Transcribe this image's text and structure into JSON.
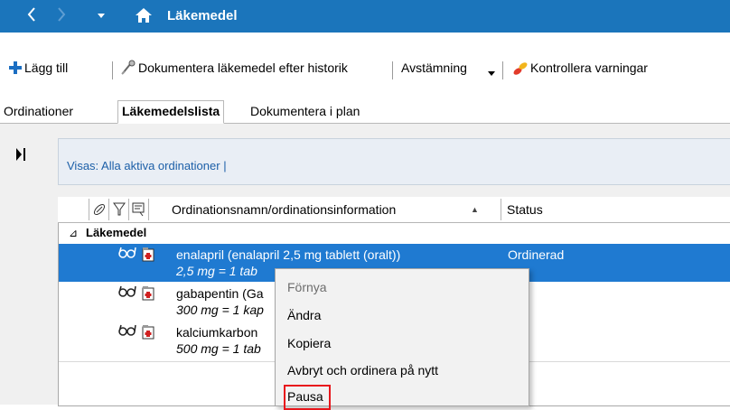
{
  "titlebar": {
    "title": "Läkemedel",
    "back_glyph": "‹",
    "forward_glyph": "›",
    "dropdown_glyph": "▾",
    "accent": "#1b75bb"
  },
  "toolbar": {
    "add_label": "Lägg till",
    "document_history_label": "Dokumentera läkemedel efter historik",
    "reconcile_label": "Avstämning",
    "check_warnings_label": "Kontrollera varningar"
  },
  "tabs": [
    {
      "label": "Ordinationer"
    },
    {
      "label": "Läkemedelslista"
    },
    {
      "label": "Dokumentera i plan"
    }
  ],
  "filter": {
    "text": "Visas: Alla aktiva ordinationer  |"
  },
  "grid": {
    "columns": {
      "name": "Ordinationsnamn/ordinationsinformation",
      "status": "Status",
      "sort_glyph": "▲"
    },
    "group_label": "Läkemedel",
    "group_glyph": "⊿",
    "rows": [
      {
        "name": "enalapril (enalapril 2,5 mg tablett (oralt))",
        "dose": "2,5 mg = 1 tab",
        "status": "Ordinerad",
        "selected": true
      },
      {
        "name": "gabapentin (Ga",
        "dose": "300 mg = 1 kap",
        "status": "",
        "selected": false
      },
      {
        "name": "kalciumkarbon",
        "dose": "500 mg = 1 tab",
        "status": "",
        "selected": false
      }
    ]
  },
  "context_menu": {
    "items": [
      {
        "label": "Förnya",
        "disabled": true
      },
      {
        "label": "Ändra",
        "disabled": false
      },
      {
        "label": "Kopiera",
        "disabled": false
      },
      {
        "label": "Avbryt och ordinera på nytt",
        "disabled": false
      },
      {
        "label": "Pausa",
        "disabled": false,
        "highlighted": true
      }
    ]
  },
  "colors": {
    "selection": "#1f7ad1",
    "highlight_border": "#e8161c",
    "add_icon": "#1b6ec2"
  }
}
